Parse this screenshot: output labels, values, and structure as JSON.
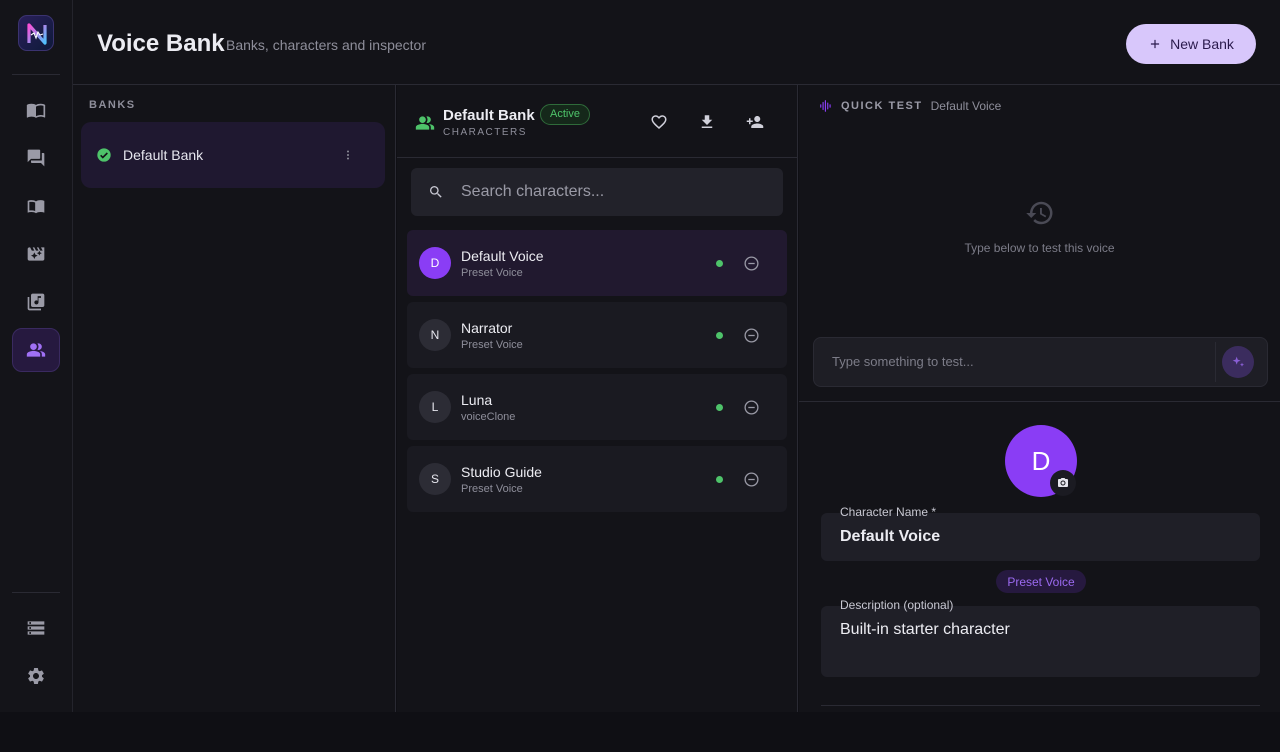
{
  "header": {
    "title": "Voice Bank",
    "subtitle": "Banks, characters and inspector",
    "new_bank_label": "New Bank"
  },
  "sidebar": {
    "items": [
      {
        "icon": "book-icon",
        "active": false
      },
      {
        "icon": "chat-icon",
        "active": false
      },
      {
        "icon": "open-book-icon",
        "active": false
      },
      {
        "icon": "movie-icon",
        "active": false
      },
      {
        "icon": "music-library-icon",
        "active": false
      },
      {
        "icon": "people-icon",
        "active": true
      }
    ],
    "bottom_items": [
      {
        "icon": "storage-icon"
      },
      {
        "icon": "gear-icon"
      }
    ]
  },
  "banks": {
    "label": "BANKS",
    "items": [
      {
        "name": "Default Bank",
        "selected": true
      }
    ]
  },
  "characters": {
    "bank_name": "Default Bank",
    "status_badge": "Active",
    "section_label": "CHARACTERS",
    "search_placeholder": "Search characters...",
    "list": [
      {
        "initial": "D",
        "name": "Default Voice",
        "type": "Preset Voice",
        "selected": true
      },
      {
        "initial": "N",
        "name": "Narrator",
        "type": "Preset Voice",
        "selected": false
      },
      {
        "initial": "L",
        "name": "Luna",
        "type": "voiceClone",
        "selected": false
      },
      {
        "initial": "S",
        "name": "Studio Guide",
        "type": "Preset Voice",
        "selected": false
      }
    ]
  },
  "inspector": {
    "quick_test_label": "QUICK TEST",
    "quick_test_voice": "Default Voice",
    "empty_hint": "Type below to test this voice",
    "test_placeholder": "Type something to test...",
    "avatar_initial": "D",
    "name_label": "Character Name *",
    "name_value": "Default Voice",
    "voice_type": "Preset Voice",
    "description_label": "Description (optional)",
    "description_value": "Built-in starter character"
  },
  "colors": {
    "accent": "#8a3df5",
    "status_green": "#4ec36a",
    "new_bank_bg": "#d8c7fb"
  }
}
